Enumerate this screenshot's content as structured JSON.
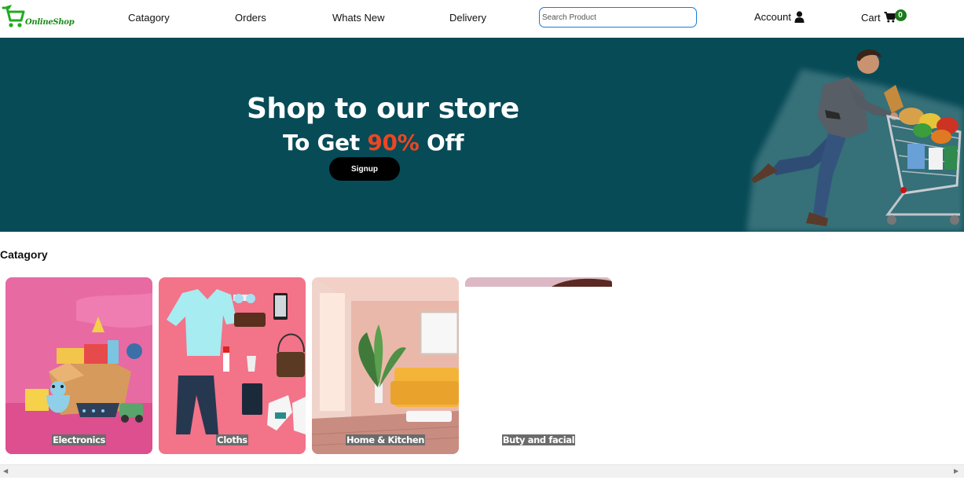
{
  "brand": {
    "name": "OnlineShop",
    "logo_icon": "shopping-cart-icon",
    "color": "#1a8a1a"
  },
  "nav": {
    "links": [
      {
        "label": "Catagory"
      },
      {
        "label": "Orders"
      },
      {
        "label": "Whats New"
      },
      {
        "label": "Delivery"
      }
    ],
    "search_placeholder": "Search Product",
    "account_label": "Account",
    "account_icon": "user-icon",
    "cart_label": "Cart",
    "cart_icon": "cart-icon",
    "cart_count": "0"
  },
  "hero": {
    "title": "Shop to our store",
    "sub_prefix": "To Get ",
    "sub_accent": "90%",
    "sub_suffix": " Off",
    "button_label": "Signup",
    "background": "#074b57",
    "accent_color": "#ee4522"
  },
  "section": {
    "title": "Catagory"
  },
  "categories": [
    {
      "label": "Electronics"
    },
    {
      "label": "Cloths"
    },
    {
      "label": "Home & Kitchen"
    },
    {
      "label": "Buty and facial"
    }
  ]
}
